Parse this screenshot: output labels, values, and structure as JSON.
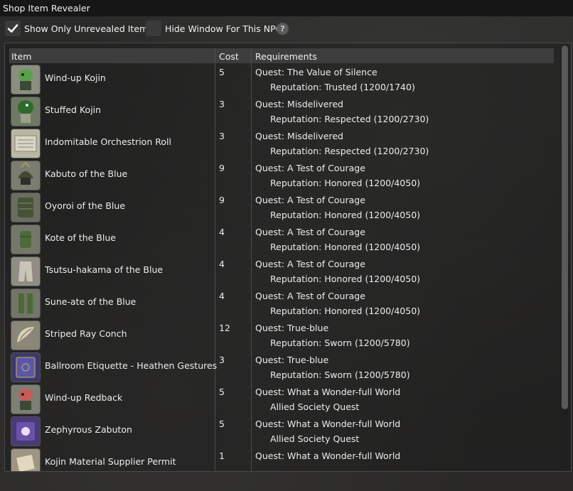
{
  "window": {
    "title": "Shop Item Revealer"
  },
  "toolbar": {
    "show_only_unrevealed": {
      "label": "Show Only Unrevealed Items",
      "checked": true
    },
    "hide_window_for_npc": {
      "label": "Hide Window For This NPC",
      "checked": false
    },
    "help_glyph": "?"
  },
  "table": {
    "headers": {
      "item": "Item",
      "cost": "Cost",
      "requirements": "Requirements"
    },
    "rows": [
      {
        "name": "Wind-up Kojin",
        "cost": "5",
        "req1": "Quest: The Value of Silence",
        "req2": "Reputation: Trusted (1200/1740)",
        "icon": "kojin-minion-icon"
      },
      {
        "name": "Stuffed Kojin",
        "cost": "3",
        "req1": "Quest: Misdelivered",
        "req2": "Reputation: Respected (1200/2730)",
        "icon": "stuffed-kojin-icon"
      },
      {
        "name": "Indomitable Orchestrion Roll",
        "cost": "3",
        "req1": "Quest: Misdelivered",
        "req2": "Reputation: Respected (1200/2730)",
        "icon": "orchestrion-roll-icon"
      },
      {
        "name": "Kabuto of the Blue",
        "cost": "9",
        "req1": "Quest: A Test of Courage",
        "req2": "Reputation: Honored (1200/4050)",
        "icon": "helmet-icon"
      },
      {
        "name": "Oyoroi of the Blue",
        "cost": "9",
        "req1": "Quest: A Test of Courage",
        "req2": "Reputation: Honored (1200/4050)",
        "icon": "armor-icon"
      },
      {
        "name": "Kote of the Blue",
        "cost": "4",
        "req1": "Quest: A Test of Courage",
        "req2": "Reputation: Honored (1200/4050)",
        "icon": "gauntlets-icon"
      },
      {
        "name": "Tsutsu-hakama of the Blue",
        "cost": "4",
        "req1": "Quest: A Test of Courage",
        "req2": "Reputation: Honored (1200/4050)",
        "icon": "trousers-icon"
      },
      {
        "name": "Sune-ate of the Blue",
        "cost": "4",
        "req1": "Quest: A Test of Courage",
        "req2": "Reputation: Honored (1200/4050)",
        "icon": "greaves-icon"
      },
      {
        "name": "Striped Ray Conch",
        "cost": "12",
        "req1": "Quest: True-blue",
        "req2": "Reputation: Sworn (1200/5780)",
        "icon": "conch-icon"
      },
      {
        "name": "Ballroom Etiquette - Heathen Gestures",
        "cost": "3",
        "req1": "Quest: True-blue",
        "req2": "Reputation: Sworn (1200/5780)",
        "icon": "book-icon"
      },
      {
        "name": "Wind-up Redback",
        "cost": "5",
        "req1": "Quest: What a Wonder-full World",
        "req2": "Allied Society Quest",
        "icon": "redback-minion-icon"
      },
      {
        "name": "Zephyrous Zabuton",
        "cost": "5",
        "req1": "Quest: What a Wonder-full World",
        "req2": "Allied Society Quest",
        "icon": "zabuton-icon"
      },
      {
        "name": "Kojin Material Supplier Permit",
        "cost": "1",
        "req1": "Quest: What a Wonder-full World",
        "req2": "",
        "icon": "permit-scroll-icon"
      }
    ]
  }
}
